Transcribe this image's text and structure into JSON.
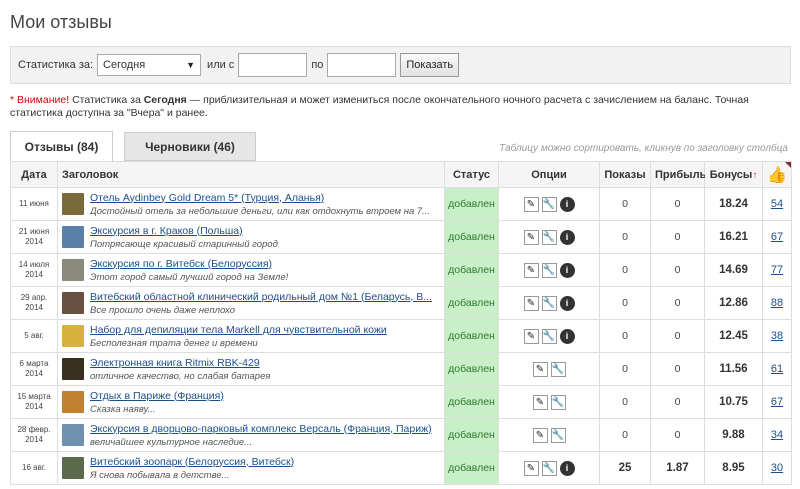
{
  "page": {
    "title": "Мои отзывы"
  },
  "stats": {
    "label": "Статистика за:",
    "period": "Сегодня",
    "or_from": "или с",
    "to": "по",
    "show_button": "Показать"
  },
  "warning": {
    "prefix": "* Внимание!",
    "part1": " Статистика за ",
    "bold": "Сегодня",
    "part2": " — приблизительная и может измениться после окончательного ночного расчета с зачислением на баланс. Точная статистика доступна за \"Вчера\" и ранее."
  },
  "tabs": [
    {
      "label": "Отзывы (84)"
    },
    {
      "label": "Черновики (46)"
    }
  ],
  "sort_hint": "Таблицу можно сортировать, кликнув по заголовку столбца",
  "columns": {
    "date": "Дата",
    "title": "Заголовок",
    "status": "Статус",
    "options": "Опции",
    "views": "Показы",
    "profit": "Прибыль",
    "bonuses": "Бонусы",
    "bonus_arrow": "↑"
  },
  "colors": {
    "status_bg": "#c9efc9",
    "link": "#1a4f8c",
    "accent_red": "#dd0000"
  },
  "rows": [
    {
      "date": "11 июня",
      "title": "Отель Aydinbey Gold Dream 5* (Турция, Аланья)",
      "subtitle": "Достойный отель за небольшие деньги, или как отдохнуть втроем на 7...",
      "status": "добавлен",
      "views": "0",
      "profit": "0",
      "bonus": "18.24",
      "likes": "54",
      "thumb": "#7a6a3a",
      "info": true
    },
    {
      "date": "21 июня 2014",
      "title": "Экскурсия в г. Краков (Польша)",
      "subtitle": "Потрясающе красивый старинный город",
      "status": "добавлен",
      "views": "0",
      "profit": "0",
      "bonus": "16.21",
      "likes": "67",
      "thumb": "#5a7fa8",
      "info": true
    },
    {
      "date": "14 июля 2014",
      "title": "Экскурсия по г. Витебск (Белоруссия)",
      "subtitle": "Этот город самый лучший город на Земле!",
      "status": "добавлен",
      "views": "0",
      "profit": "0",
      "bonus": "14.69",
      "likes": "77",
      "thumb": "#8a8a7a",
      "info": true
    },
    {
      "date": "29 апр. 2014",
      "title": "Витебский областной клинический родильный дом №1 (Беларусь, В...",
      "subtitle": "Все прошло очень даже неплохо",
      "status": "добавлен",
      "views": "0",
      "profit": "0",
      "bonus": "12.86",
      "likes": "88",
      "thumb": "#6a5040",
      "info": true
    },
    {
      "date": "5 авг.",
      "title": "Набор для депиляции тела Markell для чувствительной кожи",
      "subtitle": "Бесполезная трата денег и времени",
      "status": "добавлен",
      "views": "0",
      "profit": "0",
      "bonus": "12.45",
      "likes": "38",
      "thumb": "#d8b040",
      "info": true
    },
    {
      "date": "6 марта 2014",
      "title": "Электронная книга Ritmix RBK-429",
      "subtitle": "отличное качество, но слабая батарея",
      "status": "добавлен",
      "views": "0",
      "profit": "0",
      "bonus": "11.56",
      "likes": "61",
      "thumb": "#3a3020",
      "info": false
    },
    {
      "date": "15 марта 2014",
      "title": "Отдых в Париже (Франция)",
      "subtitle": "Сказка наяву...",
      "status": "добавлен",
      "views": "0",
      "profit": "0",
      "bonus": "10.75",
      "likes": "67",
      "thumb": "#c08030",
      "info": false
    },
    {
      "date": "28 февр. 2014",
      "title": "Экскурсия в дворцово-парковый комплекс Версаль (Франция, Париж)",
      "subtitle": "величайшее культурное наследие...",
      "status": "добавлен",
      "views": "0",
      "profit": "0",
      "bonus": "9.88",
      "likes": "34",
      "thumb": "#7090b0",
      "info": false
    },
    {
      "date": "16 авг.",
      "title": "Витебский зоопарк (Белоруссия, Витебск)",
      "subtitle": "Я снова побывала в детстве...",
      "status": "добавлен",
      "views": "25",
      "profit": "1.87",
      "bonus": "8.95",
      "likes": "30",
      "thumb": "#5a6a4a",
      "info": true
    }
  ]
}
